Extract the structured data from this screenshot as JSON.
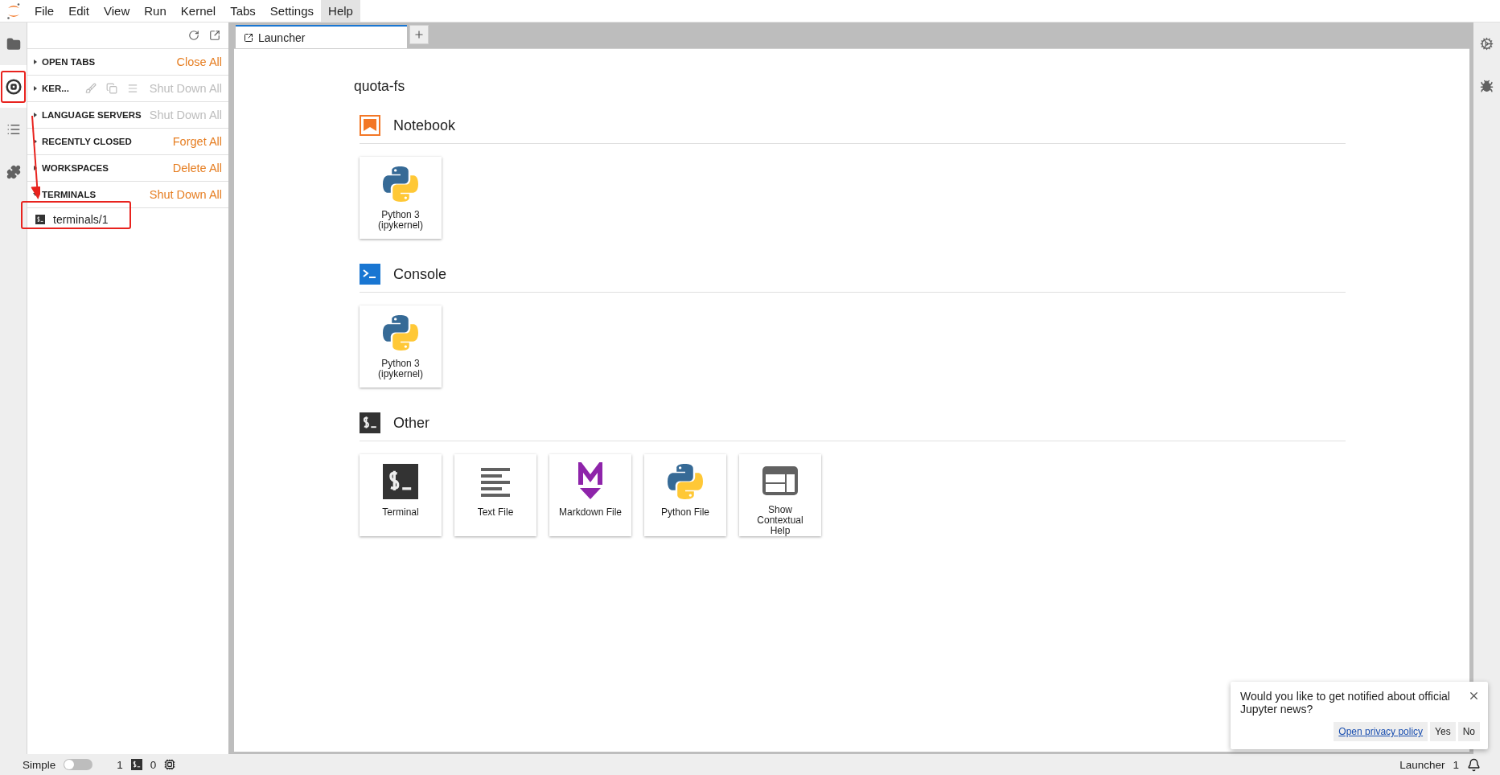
{
  "menu": [
    {
      "label": "File",
      "selected": false
    },
    {
      "label": "Edit",
      "selected": false
    },
    {
      "label": "View",
      "selected": false
    },
    {
      "label": "Run",
      "selected": false
    },
    {
      "label": "Kernel",
      "selected": false
    },
    {
      "label": "Tabs",
      "selected": false
    },
    {
      "label": "Settings",
      "selected": false
    },
    {
      "label": "Help",
      "selected": true
    }
  ],
  "activity_bar": [
    {
      "kind": "folder",
      "selected": false
    },
    {
      "kind": "running",
      "selected": true
    },
    {
      "kind": "toc",
      "selected": false
    },
    {
      "kind": "extensions",
      "selected": false
    }
  ],
  "right_bar": [
    {
      "kind": "property",
      "selected": false
    },
    {
      "kind": "debugger",
      "selected": false
    }
  ],
  "side_panel": {
    "sections": [
      {
        "title": "OPEN TABS",
        "action": "Close All",
        "expanded": false,
        "action_disabled": false,
        "kind": "plain"
      },
      {
        "title": "KER...",
        "action": "Shut Down All",
        "expanded": false,
        "action_disabled": true,
        "kind": "kernels"
      },
      {
        "title": "LANGUAGE SERVERS",
        "action": "Shut Down All",
        "expanded": false,
        "action_disabled": true,
        "kind": "plain"
      },
      {
        "title": "RECENTLY CLOSED",
        "action": "Forget All",
        "expanded": false,
        "action_disabled": false,
        "kind": "plain"
      },
      {
        "title": "WORKSPACES",
        "action": "Delete All",
        "expanded": false,
        "action_disabled": false,
        "kind": "plain"
      },
      {
        "title": "TERMINALS",
        "action": "Shut Down All",
        "expanded": true,
        "action_disabled": false,
        "kind": "plain",
        "items": [
          {
            "label": "terminals/1"
          }
        ]
      }
    ]
  },
  "tabs": [
    {
      "label": "Launcher",
      "selected": true
    }
  ],
  "launcher": {
    "cwd": "quota-fs",
    "sections": [
      {
        "title": "Notebook",
        "kind": "notebook",
        "cards": [
          {
            "label": "Python 3 (ipykernel)",
            "kind": "python"
          }
        ]
      },
      {
        "title": "Console",
        "kind": "console",
        "cards": [
          {
            "label": "Python 3 (ipykernel)",
            "kind": "python"
          }
        ]
      },
      {
        "title": "Other",
        "kind": "other",
        "cards": [
          {
            "label": "Terminal",
            "kind": "terminal"
          },
          {
            "label": "Text File",
            "kind": "text"
          },
          {
            "label": "Markdown File",
            "kind": "markdown"
          },
          {
            "label": "Python File",
            "kind": "python"
          },
          {
            "label": "Show Contextual Help",
            "kind": "help"
          }
        ]
      }
    ]
  },
  "status_bar": {
    "mode_label": "Simple",
    "simple_on": false,
    "terminals": "1",
    "kernels": "0",
    "current": "Launcher",
    "notifications": "1"
  },
  "notification": {
    "message": "Would you like to get notified about official Jupyter news?",
    "link": "Open privacy policy",
    "buttons": [
      "Yes",
      "No"
    ]
  }
}
